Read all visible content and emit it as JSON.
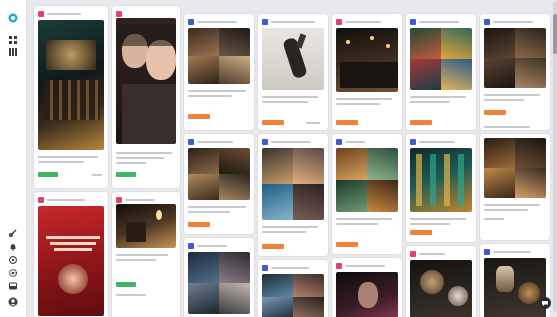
{
  "rail_icons": [
    "logo-icon",
    "grid-icon",
    "columns-icon",
    "link-icon",
    "bell-icon",
    "help-icon",
    "settings-icon",
    "inbox-icon",
    "profile-icon"
  ],
  "colors": {
    "instagram_badge": "#e0436b",
    "facebook_badge": "#3b5fcf",
    "twitter_badge": "#3aa0e6",
    "status_orange": "#f1823a",
    "status_green": "#40b56a",
    "board_background": "#e9e8ec"
  },
  "cards": [
    {
      "network": "ig",
      "status": "green",
      "photo": "bar-party"
    },
    {
      "network": "ig",
      "status": "green",
      "photo": "selfie"
    },
    {
      "network": "fb",
      "status": "orange",
      "photo": "dining-collage"
    },
    {
      "network": "fb",
      "status": "orange",
      "photo": "hand-pose"
    },
    {
      "network": "ig",
      "status": "orange",
      "photo": "dark-lounge"
    },
    {
      "network": "fb",
      "status": "orange",
      "photo": "green-bar"
    },
    {
      "network": "fb",
      "status": "orange",
      "photo": "restaurant-interior"
    },
    {
      "network": "ig",
      "status": "none",
      "photo": "red-event-poster"
    },
    {
      "network": "ig",
      "status": "green",
      "photo": "candle-bar"
    },
    {
      "network": "fb",
      "status": "orange",
      "photo": "dining-collage-2"
    },
    {
      "network": "fb",
      "status": "orange",
      "photo": "friends-collage"
    },
    {
      "network": "fb",
      "status": "orange",
      "photo": "neon-bar"
    },
    {
      "network": "fb",
      "status": "orange",
      "photo": "teal-bar"
    },
    {
      "network": "fb",
      "status": "none",
      "photo": "food-plates"
    },
    {
      "network": "fb",
      "status": "none",
      "photo": "night-collage"
    },
    {
      "network": "ig",
      "status": "none",
      "photo": "dark-collage"
    },
    {
      "network": "ig",
      "status": "none",
      "photo": "moody-portrait"
    },
    {
      "network": "ig",
      "status": "none",
      "photo": "coffee-table"
    },
    {
      "network": "fb",
      "status": "none",
      "photo": "cocktail-food"
    }
  ]
}
